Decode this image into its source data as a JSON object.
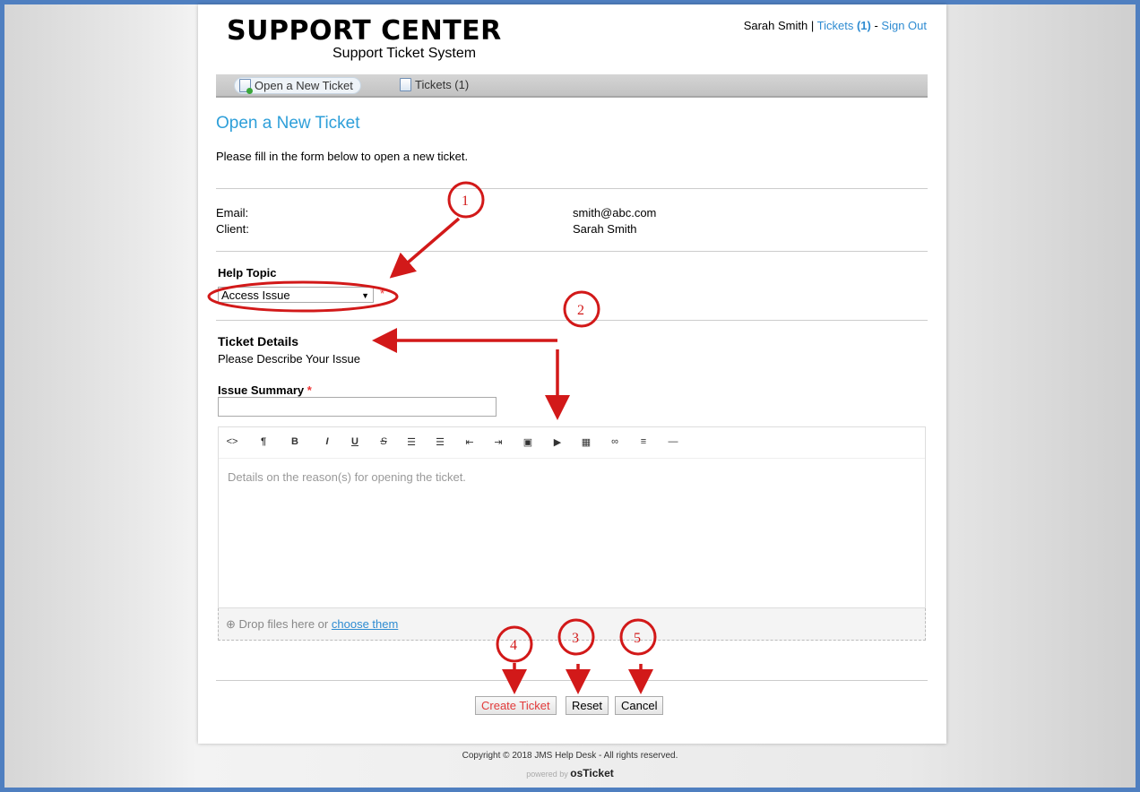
{
  "header": {
    "logo_title": "SUPPORT CENTER",
    "logo_subtitle": "Support Ticket System",
    "user_name": "Sarah Smith",
    "separator1": " | ",
    "tickets_link": "Tickets",
    "tickets_count": "(1)",
    "separator2": " - ",
    "signout_link": "Sign Out"
  },
  "nav": {
    "items": [
      {
        "label": "Open a New Ticket",
        "active": true,
        "icon": "document-add-icon"
      },
      {
        "label": "Tickets (1)",
        "active": false,
        "icon": "document-icon"
      }
    ]
  },
  "page": {
    "title": "Open a New Ticket",
    "intro": "Please fill in the form below to open a new ticket."
  },
  "contact": {
    "email_label": "Email:",
    "email_value": "smith@abc.com",
    "client_label": "Client:",
    "client_value": "Sarah Smith"
  },
  "help_topic": {
    "label": "Help Topic",
    "selected": "Access Issue",
    "required_mark": "*"
  },
  "ticket_details": {
    "heading": "Ticket Details",
    "subheading": "Please Describe Your Issue",
    "issue_summary_label": "Issue Summary",
    "required_mark": "*",
    "issue_summary_value": ""
  },
  "editor": {
    "toolbar": [
      {
        "glyph": "<>",
        "icon": "code-icon"
      },
      {
        "glyph": "¶",
        "icon": "paragraph-icon"
      },
      {
        "glyph": "B",
        "icon": "bold-icon"
      },
      {
        "glyph": "I",
        "icon": "italic-icon"
      },
      {
        "glyph": "U",
        "icon": "underline-icon"
      },
      {
        "glyph": "S",
        "icon": "strikethrough-icon"
      },
      {
        "glyph": "☰",
        "icon": "unordered-list-icon"
      },
      {
        "glyph": "☰",
        "icon": "ordered-list-icon"
      },
      {
        "glyph": "⇤",
        "icon": "outdent-icon"
      },
      {
        "glyph": "⇥",
        "icon": "indent-icon"
      },
      {
        "glyph": "▣",
        "icon": "image-icon"
      },
      {
        "glyph": "▶",
        "icon": "video-icon"
      },
      {
        "glyph": "▦",
        "icon": "table-icon"
      },
      {
        "glyph": "∞",
        "icon": "link-icon"
      },
      {
        "glyph": "≡",
        "icon": "align-icon"
      },
      {
        "glyph": "—",
        "icon": "horizontal-rule-icon"
      }
    ],
    "placeholder": "Details on the reason(s) for opening the ticket."
  },
  "dropzone": {
    "text": "Drop files here or",
    "link": "choose them"
  },
  "buttons": {
    "create": "Create Ticket",
    "reset": "Reset",
    "cancel": "Cancel"
  },
  "annotations": {
    "numbers": [
      "1",
      "2",
      "3",
      "4",
      "5"
    ],
    "color": "#d21919"
  },
  "footer": {
    "copyright": "Copyright © 2018 JMS Help Desk - All rights reserved.",
    "powered_by": "powered by",
    "brand": "osTicket"
  },
  "colors": {
    "link": "#2e8bd1",
    "title": "#2e9fd9",
    "frame": "#4f7fc0",
    "create_button_text": "#e23a3a"
  }
}
